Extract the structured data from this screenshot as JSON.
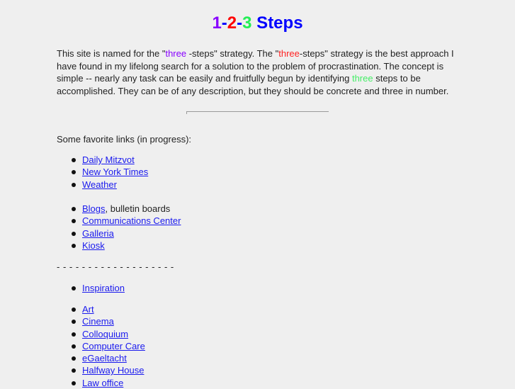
{
  "title": {
    "part1": "1",
    "dash1": "-",
    "part2": "2",
    "dash2": "-",
    "part3": "3",
    "word": " Steps"
  },
  "intro": {
    "t1": "This site is named for the \"",
    "w1": "three",
    "t2": " -steps\" strategy. The \"",
    "w2": "three",
    "t3": "-steps\" strategy is the best approach I have found in my lifelong search for a solution to the problem of procrastination. The concept is simple -- nearly any task can be easily and fruitfully begun by identifying ",
    "w3": "three",
    "t4": " steps to be accomplished.  They can be of any description, but they should be concrete and three in number."
  },
  "colors": {
    "one": "#8800ff",
    "two": "#ff0000",
    "three": "#22ee55",
    "steps": "#0000ff",
    "link": "#1a1aee",
    "background": "#efefef"
  },
  "favorites_label": "Some favorite links (in progress):",
  "list1": [
    {
      "label": "Daily Mitzvot"
    },
    {
      "label": "New York Times"
    },
    {
      "label": "Weather"
    }
  ],
  "list2": [
    {
      "label": "Blogs",
      "suffix": ", bulletin boards"
    },
    {
      "label": "Communications Center"
    },
    {
      "label": "Galleria"
    },
    {
      "label": "Kiosk"
    }
  ],
  "separator": "- - - - - - - - - - - - - - - - - - -",
  "list3": [
    {
      "label": "Inspiration"
    }
  ],
  "list4": [
    {
      "label": "Art"
    },
    {
      "label": "Cinema"
    },
    {
      "label": "Colloquium"
    },
    {
      "label": "Computer Care"
    },
    {
      "label": "eGaeltacht"
    },
    {
      "label": "Halfway House"
    },
    {
      "label": "Law office"
    }
  ]
}
